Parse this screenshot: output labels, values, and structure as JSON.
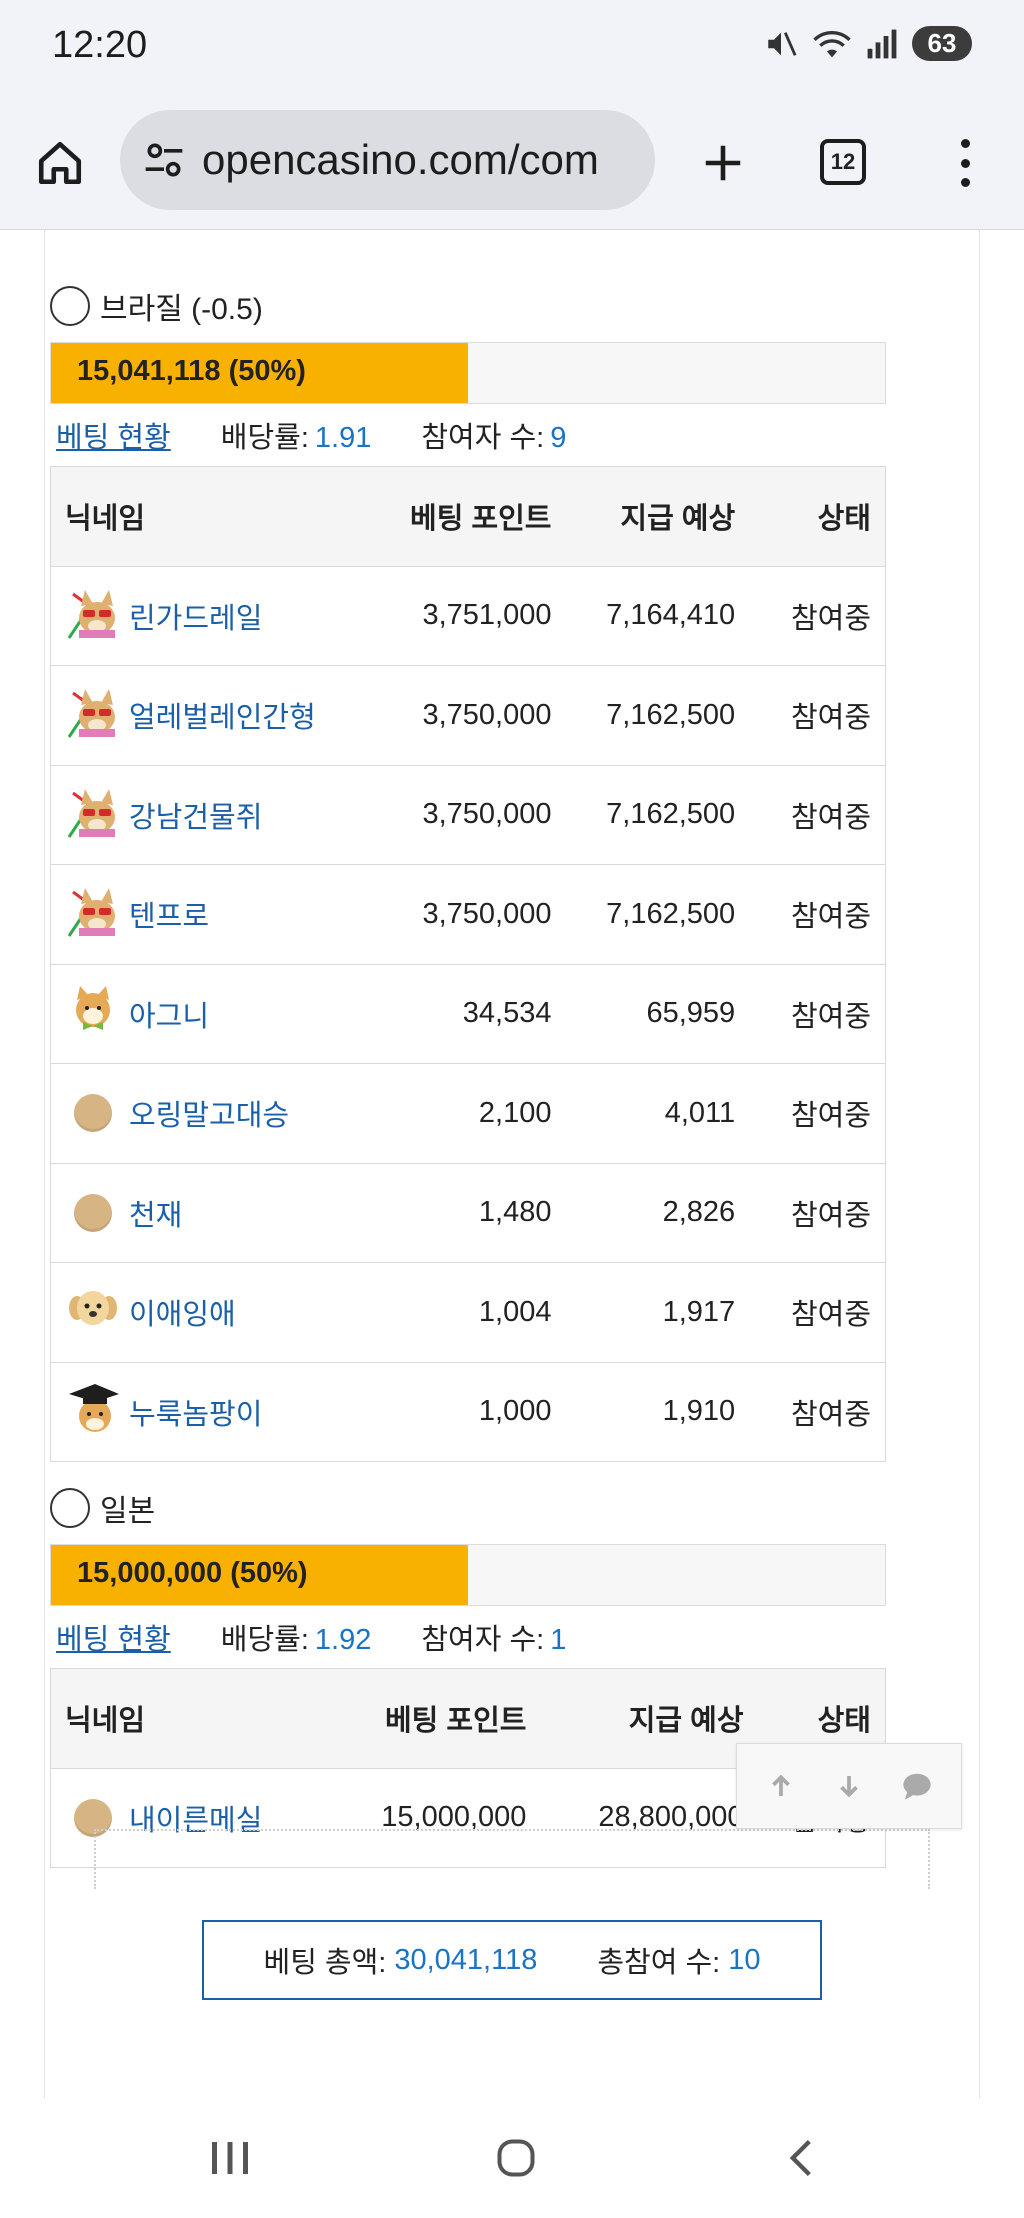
{
  "status_bar": {
    "time": "12:20",
    "battery": "63",
    "icons": [
      "mute-icon",
      "wifi-icon",
      "signal-icon",
      "battery-icon"
    ]
  },
  "browser": {
    "url": "opencasino.com/com",
    "tab_count": "12",
    "icons": [
      "home-icon",
      "site-settings-icon",
      "new-tab-icon",
      "tabs-icon",
      "menu-icon"
    ]
  },
  "sections": [
    {
      "option_label": "브라질 (-0.5)",
      "bar_label": "15,041,118 (50%)",
      "bar_percent": 50,
      "bet_status_link": "베팅 현황",
      "odds_label": "배당률:",
      "odds_value": "1.91",
      "participants_label": "참여자 수:",
      "participants_value": "9",
      "headers": {
        "nickname": "닉네임",
        "bet_points": "베팅 포인트",
        "expected_payout": "지급 예상",
        "status": "상태"
      },
      "rows": [
        {
          "avatar": "sunglasses-dog-icon",
          "nickname": "린가드레일",
          "bet": "3,751,000",
          "payout": "7,164,410",
          "status": "참여중"
        },
        {
          "avatar": "sunglasses-dog-icon",
          "nickname": "얼레벌레인간형",
          "bet": "3,750,000",
          "payout": "7,162,500",
          "status": "참여중"
        },
        {
          "avatar": "sunglasses-dog-icon",
          "nickname": "강남건물쥐",
          "bet": "3,750,000",
          "payout": "7,162,500",
          "status": "참여중"
        },
        {
          "avatar": "sunglasses-dog-icon",
          "nickname": "텐프로",
          "bet": "3,750,000",
          "payout": "7,162,500",
          "status": "참여중"
        },
        {
          "avatar": "shiba-bowtie-icon",
          "nickname": "아그니",
          "bet": "34,534",
          "payout": "65,959",
          "status": "참여중"
        },
        {
          "avatar": "coin-avatar-icon",
          "nickname": "오링말고대승",
          "bet": "2,100",
          "payout": "4,011",
          "status": "참여중"
        },
        {
          "avatar": "coin-avatar-icon",
          "nickname": "천재",
          "bet": "1,480",
          "payout": "2,826",
          "status": "참여중"
        },
        {
          "avatar": "puppy-icon",
          "nickname": "이애잉애",
          "bet": "1,004",
          "payout": "1,917",
          "status": "참여중"
        },
        {
          "avatar": "graduate-dog-icon",
          "nickname": "누룩놈팡이",
          "bet": "1,000",
          "payout": "1,910",
          "status": "참여중"
        }
      ]
    },
    {
      "option_label": "일본",
      "bar_label": "15,000,000 (50%)",
      "bar_percent": 50,
      "bet_status_link": "베팅 현황",
      "odds_label": "배당률:",
      "odds_value": "1.92",
      "participants_label": "참여자 수:",
      "participants_value": "1",
      "headers": {
        "nickname": "닉네임",
        "bet_points": "베팅 포인트",
        "expected_payout": "지급 예상",
        "status": "상태"
      },
      "rows": [
        {
          "avatar": "coin-avatar-icon",
          "nickname": "내이른메실",
          "bet": "15,000,000",
          "payout": "28,800,000",
          "status": "참여중"
        }
      ]
    }
  ],
  "totals": {
    "total_label": "베팅 총액:",
    "total_value": "30,041,118",
    "count_label": "총참여 수:",
    "count_value": "10"
  },
  "floating_buttons": [
    "scroll-up-icon",
    "scroll-down-icon",
    "comment-icon"
  ],
  "navigation_bar": [
    "recent-apps-icon",
    "home-circle-icon",
    "back-icon"
  ]
}
